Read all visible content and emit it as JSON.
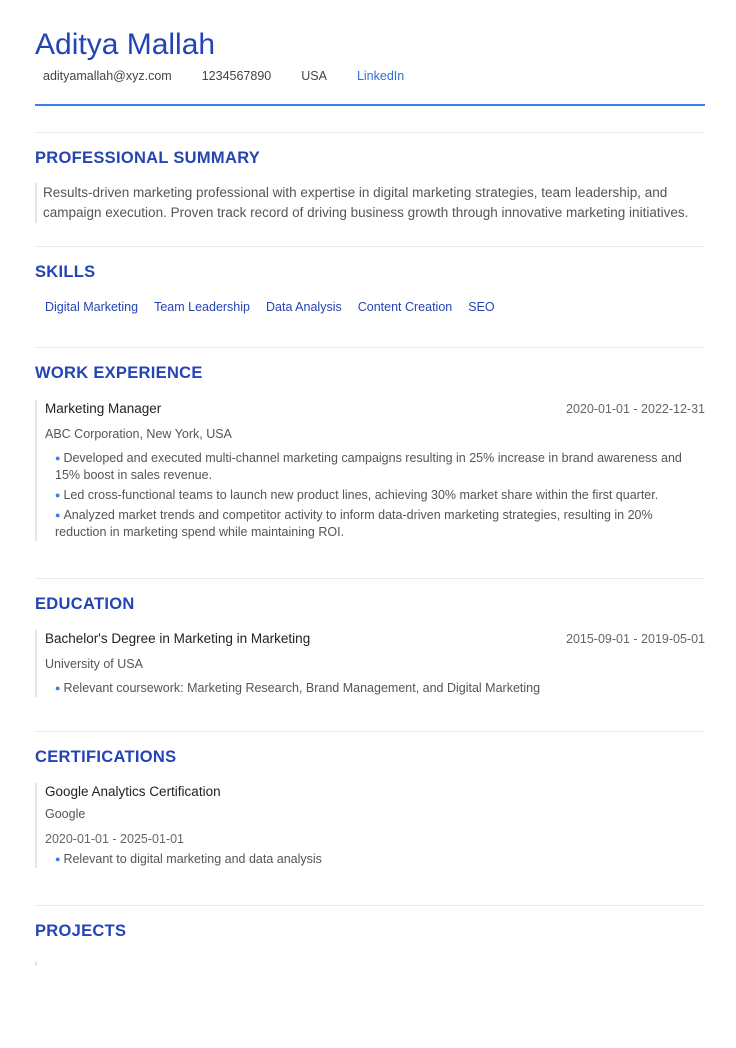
{
  "header": {
    "name": "Aditya Mallah",
    "email": "adityamallah@xyz.com",
    "phone": "1234567890",
    "location": "USA",
    "linkedin_label": "LinkedIn"
  },
  "summary": {
    "title": "PROFESSIONAL SUMMARY",
    "text": "Results-driven marketing professional with expertise in digital marketing strategies, team leadership, and campaign execution. Proven track record of driving business growth through innovative marketing initiatives."
  },
  "skills": {
    "title": "SKILLS",
    "items": [
      "Digital Marketing",
      "Team Leadership",
      "Data Analysis",
      "Content Creation",
      "SEO"
    ]
  },
  "experience": {
    "title": "WORK EXPERIENCE",
    "items": [
      {
        "role": "Marketing Manager",
        "dates": "2020-01-01 - 2022-12-31",
        "company": "ABC Corporation, New York, USA",
        "bullets": [
          "Developed and executed multi-channel marketing campaigns resulting in 25% increase in brand awareness and 15% boost in sales revenue.",
          "Led cross-functional teams to launch new product lines, achieving 30% market share within the first quarter.",
          "Analyzed market trends and competitor activity to inform data-driven marketing strategies, resulting in 20% reduction in marketing spend while maintaining ROI."
        ]
      }
    ]
  },
  "education": {
    "title": "EDUCATION",
    "items": [
      {
        "degree": "Bachelor's Degree in Marketing in Marketing",
        "dates": "2015-09-01 - 2019-05-01",
        "school": "University of USA",
        "bullets": [
          "Relevant coursework: Marketing Research, Brand Management, and Digital Marketing"
        ]
      }
    ]
  },
  "certifications": {
    "title": "CERTIFICATIONS",
    "items": [
      {
        "name": "Google Analytics Certification",
        "issuer": "Google",
        "dates": "2020-01-01 - 2025-01-01",
        "bullets": [
          "Relevant to digital marketing and data analysis"
        ]
      }
    ]
  },
  "projects": {
    "title": "PROJECTS"
  },
  "colors": {
    "accent": "#2444b4",
    "rule": "#3d7de6",
    "link": "#2f6fdc"
  }
}
